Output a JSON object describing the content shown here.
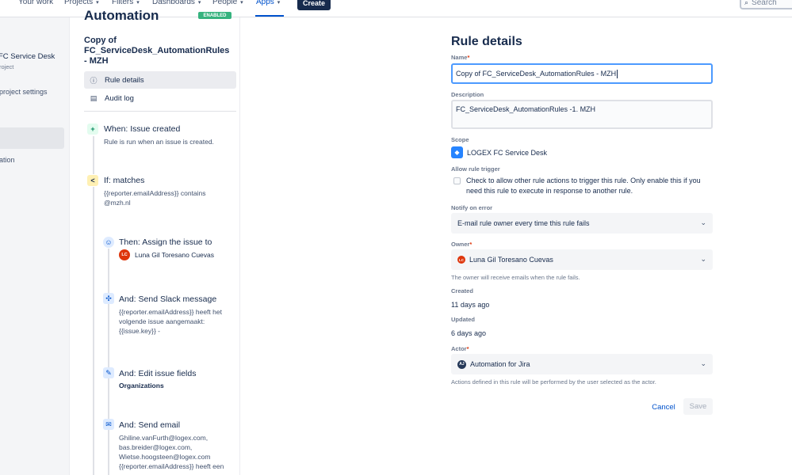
{
  "nav": {
    "items": [
      {
        "label": "Your work"
      },
      {
        "label": "Projects"
      },
      {
        "label": "Filters"
      },
      {
        "label": "Dashboards"
      },
      {
        "label": "People"
      },
      {
        "label": "Apps"
      }
    ],
    "create_label": "Create",
    "search_placeholder": "Search"
  },
  "sidebar": {
    "project_name": "FC Service Desk",
    "project_type": "roject",
    "settings_label": "project settings",
    "automation_label": "ation"
  },
  "rules_column": {
    "heading": "Automation",
    "status": "ENABLED",
    "rule_name": "Copy of FC_ServiceDesk_AutomationRules - MZH",
    "menu": [
      {
        "label": "Rule details",
        "icon": "info-icon"
      },
      {
        "label": "Audit log",
        "icon": "document-icon"
      }
    ],
    "timeline": {
      "trigger": {
        "title": "When: Issue created",
        "text": "Rule is run when an issue is created."
      },
      "condition": {
        "title": "If: matches",
        "text": "{{reporter.emailAddress}} contains @mzh.nl"
      },
      "assign": {
        "title": "Then: Assign the issue to",
        "assignee": "Luna Gil Toresano Cuevas",
        "initials": "LC"
      },
      "slack": {
        "title": "And: Send Slack message",
        "text": "{{reporter.emailAddress}} heeft het volgende issue aangemaakt: {{issue.key}} -"
      },
      "edit": {
        "title": "And: Edit issue fields",
        "field": "Organizations"
      },
      "email": {
        "title": "And: Send email",
        "text": "Ghiline.vanFurth@logex.com, bas.breider@logex.com, Wietse.hoogsteen@logex.com {{reporter.emailAddress}} heeft een"
      }
    }
  },
  "details": {
    "heading": "Rule details",
    "name_label": "Name",
    "name_value": "Copy of FC_ServiceDesk_AutomationRules - MZH",
    "description_label": "Description",
    "description_value": "FC_ServiceDesk_AutomationRules -1. MZH",
    "scope_label": "Scope",
    "scope_value": "LOGEX FC Service Desk",
    "allow_trigger_label": "Allow rule trigger",
    "allow_trigger_text": "Check to allow other rule actions to trigger this rule. Only enable this if you need this rule to execute in response to another rule.",
    "notify_label": "Notify on error",
    "notify_value": "E-mail rule owner every time this rule fails",
    "owner_label": "Owner",
    "owner_value": "Luna Gil Toresano Cuevas",
    "owner_initials": "LC",
    "owner_help": "The owner will receive emails when the rule fails.",
    "created_label": "Created",
    "created_value": "11 days ago",
    "updated_label": "Updated",
    "updated_value": "6 days ago",
    "actor_label": "Actor",
    "actor_value": "Automation for Jira",
    "actor_initials": "AJ",
    "actor_help": "Actions defined in this rule will be performed by the user selected as the actor.",
    "cancel_label": "Cancel",
    "save_label": "Save",
    "required_mark": "*"
  },
  "colors": {
    "accent": "#0052cc",
    "focus": "#4c9aff",
    "enabled": "#36b37e",
    "avatar": "#de350b"
  }
}
